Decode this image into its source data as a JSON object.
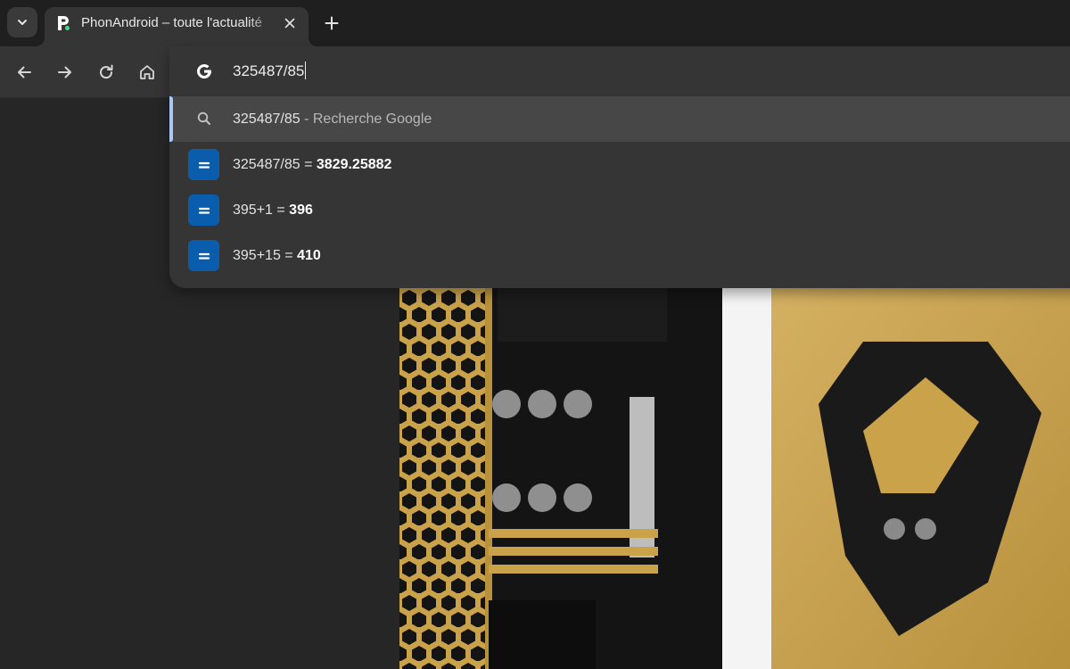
{
  "tab": {
    "title": "PhonAndroid – toute l'actualité"
  },
  "omnibox": {
    "input_value": "325487/85",
    "suggestions": [
      {
        "main": "325487/85",
        "sub": " - Recherche Google",
        "type": "search",
        "icon": "search-icon"
      },
      {
        "expr": "325487/85 = ",
        "result": "3829.25882",
        "type": "calculator",
        "icon": "calculator-icon"
      },
      {
        "expr": "395+1 = ",
        "result": "396",
        "type": "calculator",
        "icon": "calculator-icon"
      },
      {
        "expr": "395+15 = ",
        "result": "410",
        "type": "calculator",
        "icon": "calculator-icon"
      }
    ]
  },
  "colors": {
    "accent": "#a8c7fa",
    "calculator_badge": "#0a5cad",
    "favicon": "#4ade80"
  }
}
